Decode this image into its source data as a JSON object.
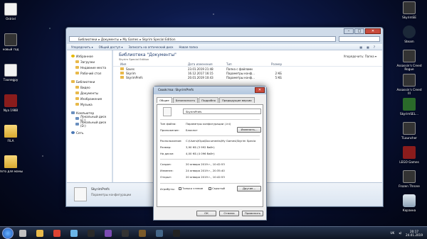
{
  "desktop": {
    "left_icons": [
      {
        "label": "Ostriel",
        "kind": "doc"
      },
      {
        "label": "новый год",
        "kind": "app"
      },
      {
        "label": "Таоnegpy",
        "kind": "doc"
      },
      {
        "label": "Nya 1988",
        "kind": "red"
      },
      {
        "label": "FILA",
        "kind": "folder"
      },
      {
        "label": "Фото для мамы",
        "kind": "folder"
      }
    ],
    "right_icons": [
      {
        "label": "SkyrimSE",
        "kind": "app"
      },
      {
        "label": "Steam",
        "kind": "steam"
      },
      {
        "label": "Assassin's Creed Rogue",
        "kind": "app"
      },
      {
        "label": "Assassin's Creed III",
        "kind": "app"
      },
      {
        "label": "SkyrimSEL...",
        "kind": "green"
      },
      {
        "label": "TLauncher",
        "kind": "app"
      },
      {
        "label": "LEGO Games",
        "kind": "red"
      },
      {
        "label": "Frozen Throne",
        "kind": "app"
      },
      {
        "label": "Корзина",
        "kind": "bin"
      }
    ]
  },
  "explorer": {
    "breadcrumb": [
      "Библиотеки",
      "Документы",
      "My Games",
      "Skyrim Special Edition"
    ],
    "toolbar": [
      "Упорядочить ▾",
      "Общий доступ ▾",
      "Записать на оптический диск",
      "Новая папка"
    ],
    "view_buttons": [
      "Упорядочить: Папка ▾"
    ],
    "nav": [
      {
        "label": "Избранное",
        "icon": "star",
        "level": 0
      },
      {
        "label": "Загрузки",
        "icon": "folder",
        "level": 1
      },
      {
        "label": "Недавние места",
        "icon": "folder",
        "level": 1
      },
      {
        "label": "Рабочий стол",
        "icon": "folder",
        "level": 1
      },
      {
        "label": "Библиотеки",
        "icon": "folder",
        "level": 0
      },
      {
        "label": "Видео",
        "icon": "folder",
        "level": 1
      },
      {
        "label": "Документы",
        "icon": "folder",
        "level": 1
      },
      {
        "label": "Изображения",
        "icon": "folder",
        "level": 1
      },
      {
        "label": "Музыка",
        "icon": "folder",
        "level": 1
      },
      {
        "label": "Компьютер",
        "icon": "pc",
        "level": 0
      },
      {
        "label": "Локальный диск (C:)",
        "icon": "pc",
        "level": 1
      },
      {
        "label": "Локальный диск (D:)",
        "icon": "pc",
        "level": 1
      },
      {
        "label": "Сеть",
        "icon": "net",
        "level": 0
      }
    ],
    "library_title": "Библиотека \"Документы\"",
    "library_subtitle": "Skyrim Special Edition",
    "columns": [
      "Имя",
      "Дата изменения",
      "Тип",
      "Размер"
    ],
    "files": [
      {
        "name": "Saves",
        "date": "23.01.2019 21:48",
        "type": "Папка с файлами",
        "size": ""
      },
      {
        "name": "Skyrim",
        "date": "16.12.2017 16:15",
        "type": "Параметры конф...",
        "size": "2 КБ"
      },
      {
        "name": "SkyrimPrefs",
        "date": "20.01.2019 10:43",
        "type": "Параметры конф...",
        "size": "5 КБ"
      }
    ],
    "details_name": "SkyrimPrefs",
    "details_type": "Параметры конфигурации"
  },
  "dialog": {
    "title": "Свойства: SkyrimPrefs",
    "tabs": [
      "Общие",
      "Безопасность",
      "Подробно",
      "Предыдущие версии"
    ],
    "filename": "SkyrimPrefs",
    "fields": [
      {
        "label": "Тип файла:",
        "value": "Параметры конфигурации (.ini)"
      },
      {
        "label": "Приложение:",
        "value": "Блокнот"
      },
      {
        "label": "Расположение:",
        "value": "C:\\Users\\Юра\\Documents\\My Games\\Skyrim Specia"
      },
      {
        "label": "Размер:",
        "value": "3,90 КБ (3 992 байт)"
      },
      {
        "label": "На диске:",
        "value": "4,00 КБ (4 096 байт)"
      },
      {
        "label": "Создан:",
        "value": "20 января 2019 г., 10:42:53"
      },
      {
        "label": "Изменен:",
        "value": "24 января 2019 г., 20:35:40"
      },
      {
        "label": "Открыт:",
        "value": "20 января 2019 г., 10:42:53"
      }
    ],
    "attributes_label": "Атрибуты:",
    "readonly_label": "Только чтение",
    "hidden_label": "Скрытый",
    "change_button": "Изменить...",
    "other_button": "Другие...",
    "ok_button": "ОК",
    "cancel_button": "Отмена",
    "apply_button": "Применить"
  },
  "taskbar": {
    "apps": [
      "#c0c0c0",
      "#e8b94a",
      "#dd4433",
      "#6bb5e8",
      "#2a2a2a",
      "#7b4bb3",
      "#333333",
      "#7a5a2a",
      "#446688",
      "#222222"
    ],
    "language": "UK",
    "time": "20:17",
    "date": "24.01.2019"
  }
}
